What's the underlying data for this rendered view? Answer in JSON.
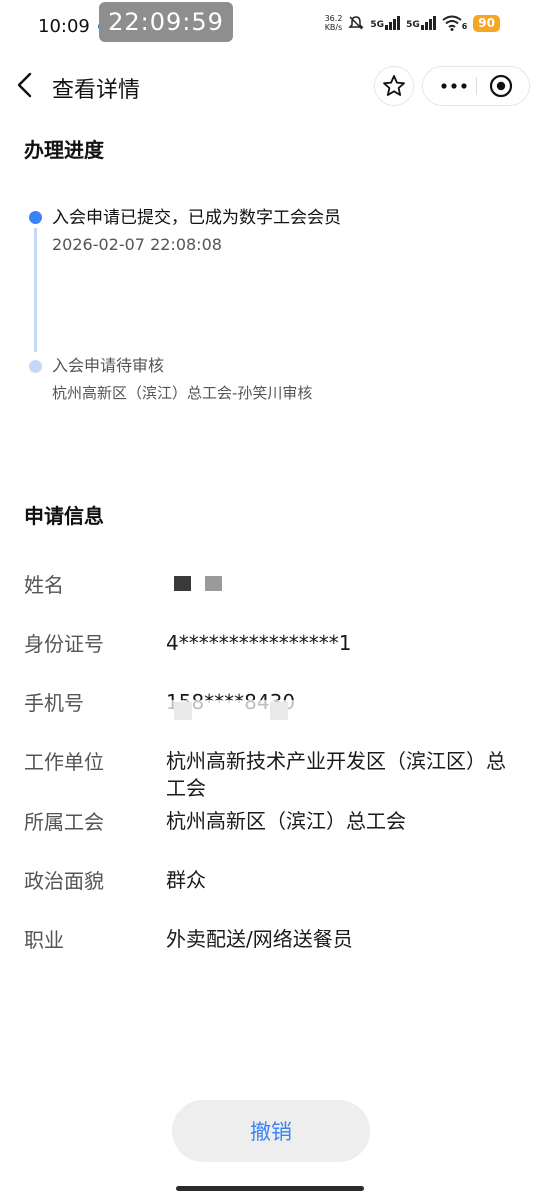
{
  "status_bar": {
    "time": "10:09",
    "clock_overlay": "22:09:59",
    "speed_value": "36.2",
    "speed_unit": "KB/s",
    "signal1_label": "5G",
    "signal2_label": "5G",
    "wifi_label": "6",
    "battery": "90"
  },
  "nav": {
    "title": "查看详情",
    "icons": [
      "back-arrow-icon",
      "star-icon",
      "more-icon",
      "close-circle-icon"
    ]
  },
  "progress": {
    "section_title": "办理进度",
    "steps": [
      {
        "title": "入会申请已提交，已成为数字工会会员",
        "detail": "2026-02-07 22:08:08",
        "state": "done"
      },
      {
        "title": "入会申请待审核",
        "detail": "杭州高新区（滨江）总工会-孙笑川审核",
        "state": "pending"
      }
    ]
  },
  "application": {
    "section_title": "申请信息",
    "rows": [
      {
        "label": "姓名",
        "value": ""
      },
      {
        "label": "身份证号",
        "value": "4****************1"
      },
      {
        "label": "手机号",
        "value": "158****8430"
      },
      {
        "label": "工作单位",
        "value": "杭州高新技术产业开发区（滨江区）总工会"
      },
      {
        "label": "所属工会",
        "value": "杭州高新区（滨江）总工会"
      },
      {
        "label": "政治面貌",
        "value": "群众"
      },
      {
        "label": "职业",
        "value": "外卖配送/网络送餐员"
      }
    ]
  },
  "actions": {
    "revoke_label": "撤销"
  },
  "colors": {
    "accent": "#3b82f6",
    "timeline_pending": "#c6d8f7",
    "battery": "#f5a623"
  }
}
